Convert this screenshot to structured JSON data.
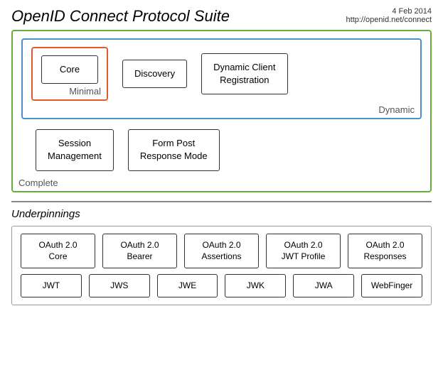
{
  "header": {
    "title": "OpenID Connect Protocol Suite",
    "date": "4 Feb 2014",
    "url": "http://openid.net/connect"
  },
  "complete_label": "Complete",
  "dynamic_label": "Dynamic",
  "minimal_label": "Minimal",
  "boxes": {
    "core": "Core",
    "discovery": "Discovery",
    "dynamic_client_reg": "Dynamic Client\nRegistration",
    "session_mgmt": "Session\nManagement",
    "form_post": "Form Post\nResponse Mode"
  },
  "underpinnings": {
    "title": "Underpinnings",
    "row1": [
      "OAuth 2.0\nCore",
      "OAuth 2.0\nBearer",
      "OAuth 2.0\nAssertions",
      "OAuth 2.0\nJWT Profile",
      "OAuth 2.0\nResponses"
    ],
    "row2": [
      "JWT",
      "JWS",
      "JWE",
      "JWK",
      "JWA",
      "WebFinger"
    ]
  }
}
